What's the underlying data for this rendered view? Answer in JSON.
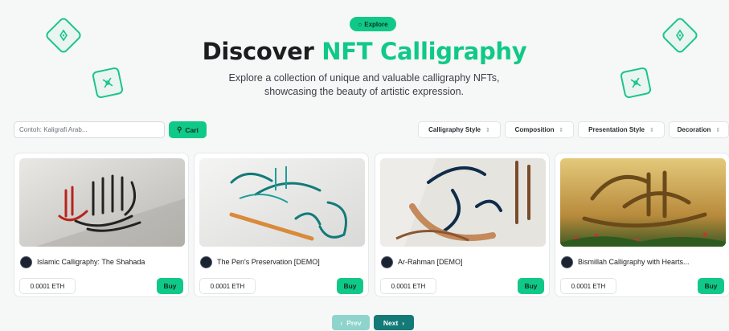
{
  "hero": {
    "badge_label": "Explore",
    "title_plain": "Discover ",
    "title_accent": "NFT Calligraphy",
    "subtitle_line1": "Explore a collection of unique and valuable calligraphy NFTs,",
    "subtitle_line2": "showcasing the beauty of artistic expression."
  },
  "search": {
    "placeholder": "Contoh: Kaligrafi Arab...",
    "value": "",
    "button_label": "Cari"
  },
  "filters": [
    {
      "label": "Calligraphy Style"
    },
    {
      "label": "Composition"
    },
    {
      "label": "Presentation Style"
    },
    {
      "label": "Decoration"
    }
  ],
  "cards": [
    {
      "name": "Islamic Calligraphy: The Shahada",
      "price": "0.0001 ETH",
      "buy_label": "Buy"
    },
    {
      "name": "The Pen's Preservation [DEMO]",
      "price": "0.0001 ETH",
      "buy_label": "Buy"
    },
    {
      "name": "Ar-Rahman [DEMO]",
      "price": "0.0001 ETH",
      "buy_label": "Buy"
    },
    {
      "name": "Bismillah Calligraphy with Hearts...",
      "price": "0.0001 ETH",
      "buy_label": "Buy"
    }
  ],
  "pagination": {
    "prev_label": "Prev",
    "next_label": "Next"
  },
  "colors": {
    "accent": "#10c989",
    "next_button": "#137a78",
    "prev_button_disabled": "#8fd4cc"
  },
  "icons": {
    "badge": "compass-icon",
    "search": "search-icon",
    "deco_top_left": "pen-nib-icon",
    "deco_left": "pencil-ruler-icon",
    "deco_top_right": "pen-nib-icon",
    "deco_right": "pencil-ruler-icon"
  }
}
